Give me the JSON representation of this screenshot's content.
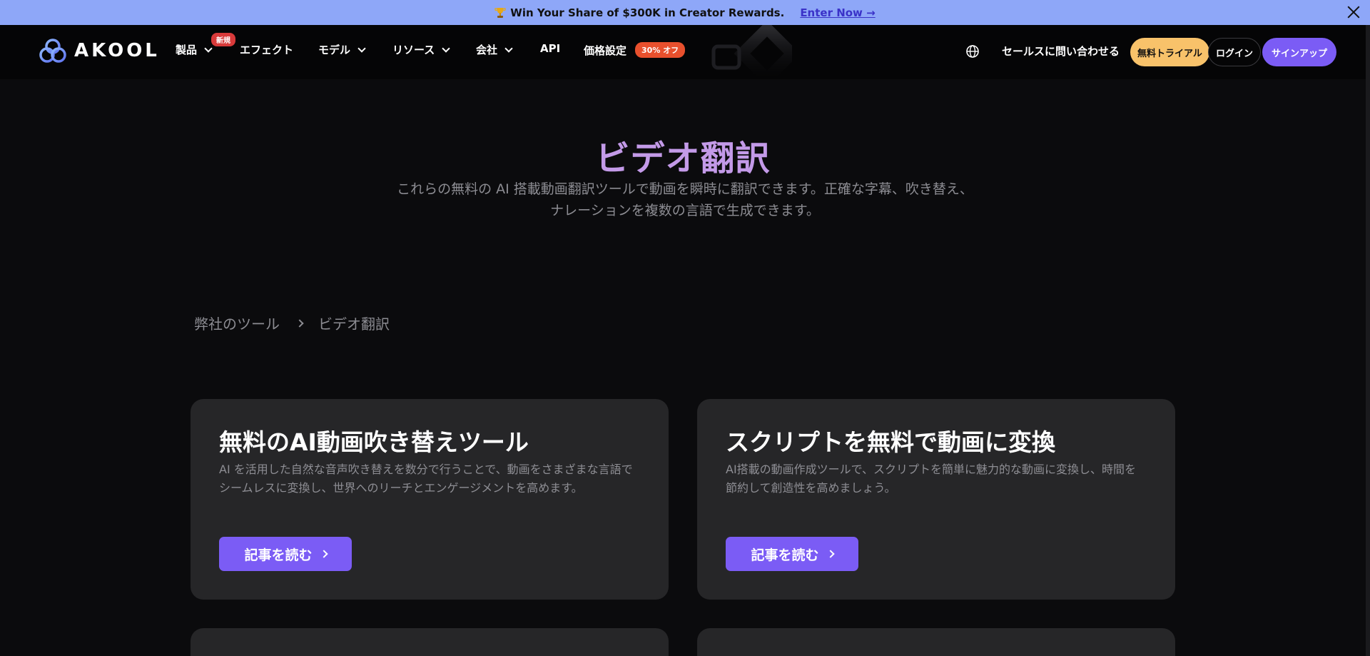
{
  "banner": {
    "trophy_icon": "trophy-icon",
    "text": "Win Your Share of $300K in Creator Rewards.",
    "link": "Enter Now →",
    "bg_color": "#8ea7f8"
  },
  "nav": {
    "logo": "AKOOL",
    "items": [
      {
        "label": "製品",
        "dropdown": true,
        "badge": "新規"
      },
      {
        "label": "エフェクト",
        "dropdown": false
      },
      {
        "label": "モデル",
        "dropdown": true
      },
      {
        "label": "リソース",
        "dropdown": true
      },
      {
        "label": "会社",
        "dropdown": true
      },
      {
        "label": "API",
        "dropdown": false
      },
      {
        "label": "価格設定",
        "dropdown": false,
        "badge": "30% オフ"
      }
    ],
    "contact": "セールスに問い合わせる",
    "trial": "無料トライアル",
    "login": "ログイン",
    "signup": "サインアップ",
    "accent": "#7b5cf5",
    "trial_color": "#f8c26a"
  },
  "hero": {
    "title": "ビデオ翻訳",
    "description_line1": "これらの無料の AI 搭載動画翻訳ツールで動画を瞬時に翻訳できます。正確な字幕、吹き替え、",
    "description_line2": "ナレーションを複数の言語で生成できます。",
    "title_color": "#c39ae8"
  },
  "breadcrumb": {
    "root": "弊社のツール",
    "current": "ビデオ翻訳"
  },
  "cards": [
    {
      "title": "無料のAI動画吹き替えツール",
      "description_line1": "AI を活用した自然な音声吹き替えを数分で行うことで、動画をさまざまな言語で",
      "description_line2": "シームレスに変換し、世界へのリーチとエンゲージメントを高めます。",
      "button": "記事を読む"
    },
    {
      "title": "スクリプトを無料で動画に変換",
      "description_line1": "AI搭載の動画作成ツールで、スクリプトを簡単に魅力的な動画に変換し、時間を",
      "description_line2": "節約して創造性を高めましょう。",
      "button": "記事を読む"
    }
  ]
}
